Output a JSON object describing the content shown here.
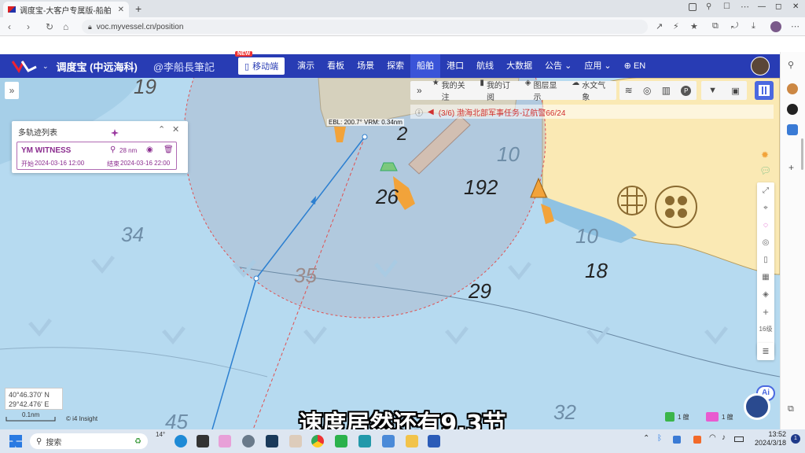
{
  "browser": {
    "tab_title": "调度宝-大客户专属版-船舶",
    "url": "voc.myvessel.cn/position",
    "new_tab_symbol": "+",
    "window_controls": [
      "—",
      "◻",
      "✕"
    ]
  },
  "app": {
    "brand": "调度宝 (中远海科)",
    "watermark": "@李船長筆記",
    "mobile_badge": "NEW",
    "mobile_label": "移动端",
    "nav_items": [
      "演示",
      "看板",
      "场景",
      "探索",
      "船舶",
      "港口",
      "航线",
      "大数据",
      "公告",
      "应用",
      "EN"
    ],
    "active_nav": "船舶",
    "accent": "#283cb4"
  },
  "toolbar": {
    "items": [
      "我的关注",
      "我的订阅",
      "图层显示",
      "水文气象"
    ]
  },
  "alert": {
    "text": "(3/6) 渤海北部军事任务-辽航警66/24"
  },
  "track_panel": {
    "title": "多轨迹列表",
    "vessel": "YM WITNESS",
    "distance": "28 nm",
    "start_label": "开始",
    "start": "2024-03-16 12:00",
    "end_label": "结束",
    "end": "2024-03-16 22:00"
  },
  "map": {
    "ebl_label": "EBL: 200.7° VRM: 0.34nm",
    "depths": [
      "19",
      "2",
      "34",
      "10",
      "26",
      "192",
      "10",
      "18",
      "35",
      "29",
      "45",
      "32"
    ],
    "zoom_level": "16级",
    "lat": "40°46.370' N",
    "lon": "29°42.476' E",
    "scale": "0.1nm",
    "attribution": "© i4 Insight",
    "legend_green": "1 艘",
    "legend_pink": "1 艘",
    "ai_label": "Ai"
  },
  "subtitle": "速度居然还有9.3节",
  "taskbar": {
    "search": "搜索",
    "weather": "14°",
    "time": "13:52",
    "date": "2024/3/18"
  }
}
